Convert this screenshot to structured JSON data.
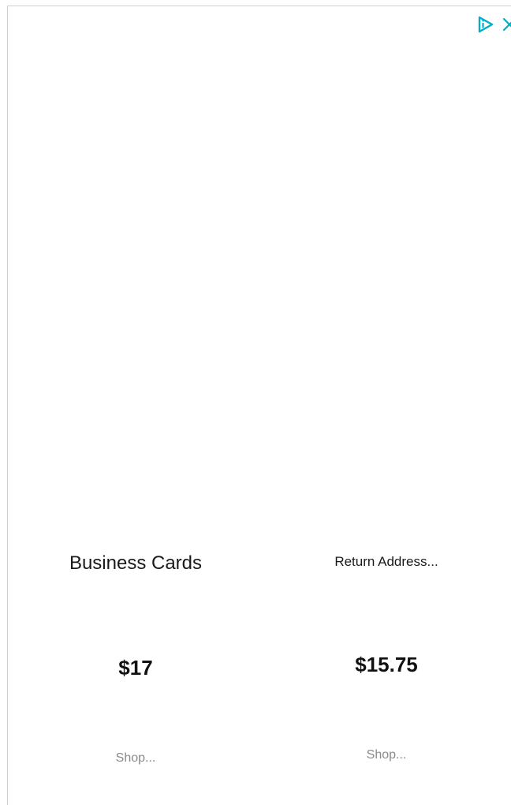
{
  "ad": {
    "icons": {
      "adchoices": "adchoices-icon",
      "close": "close-icon"
    },
    "accent": "#00aec8"
  },
  "products": [
    {
      "title": "Business Cards",
      "price": "$17",
      "link": "Shop..."
    },
    {
      "title": "Return Address...",
      "price": "$15.75",
      "link": "Shop..."
    }
  ]
}
